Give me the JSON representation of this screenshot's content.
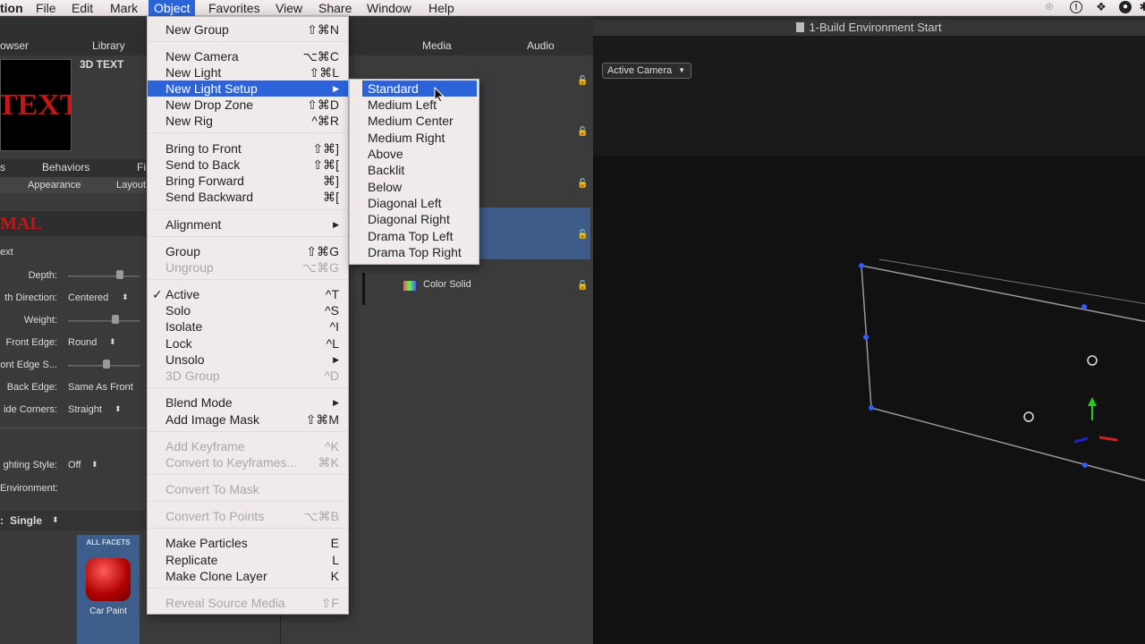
{
  "menubar": {
    "app": "tion",
    "items": [
      "File",
      "Edit",
      "Mark",
      "Object",
      "Favorites",
      "View",
      "Share",
      "Window",
      "Help"
    ],
    "active": "Object"
  },
  "window": {
    "title": "1-Build Environment Start"
  },
  "left_panel": {
    "tabs_top": [
      "owser",
      "Library"
    ],
    "preview_title": "3D TEXT",
    "preview_text": "TEXT",
    "tabs_mid": [
      "s",
      "Behaviors",
      "Fi"
    ],
    "subtabs": [
      "Appearance",
      "Layout"
    ],
    "style_title": "MAL",
    "section": "ext",
    "rows": [
      {
        "label": "Depth:",
        "value": ""
      },
      {
        "label": "th Direction:",
        "value": "Centered"
      },
      {
        "label": "Weight:",
        "value": ""
      },
      {
        "label": "Front Edge:",
        "value": "Round"
      },
      {
        "label": "ont Edge S...",
        "value": ""
      },
      {
        "label": "Back Edge:",
        "value": "Same As Front"
      },
      {
        "label": "ide Corners:",
        "value": "Straight"
      },
      {
        "label": "ghting Style:",
        "value": "Off"
      },
      {
        "label": "Environment:",
        "value": ""
      }
    ],
    "material_mode": "Single",
    "facets_label": "ALL FACETS",
    "material_name": "Car Paint"
  },
  "middle_panel": {
    "tabs": [
      "Media",
      "Audio"
    ],
    "layer_label": "Color Solid"
  },
  "viewer": {
    "camera": "Active Camera"
  },
  "object_menu": {
    "items": [
      {
        "label": "New Group",
        "shortcut": "⇧⌘N"
      },
      {
        "label": "New Camera",
        "shortcut": "⌥⌘C"
      },
      {
        "label": "New Light",
        "shortcut": "⇧⌘L"
      },
      {
        "label": "New Light Setup",
        "shortcut": "▶"
      },
      {
        "label": "New Drop Zone",
        "shortcut": "⇧⌘D"
      },
      {
        "label": "New Rig",
        "shortcut": "^⌘R"
      },
      {
        "label": "Bring to Front",
        "shortcut": "⇧⌘]"
      },
      {
        "label": "Send to Back",
        "shortcut": "⇧⌘["
      },
      {
        "label": "Bring Forward",
        "shortcut": "⌘]"
      },
      {
        "label": "Send Backward",
        "shortcut": "⌘["
      },
      {
        "label": "Alignment",
        "shortcut": "▶"
      },
      {
        "label": "Group",
        "shortcut": "⇧⌘G"
      },
      {
        "label": "Ungroup",
        "shortcut": "⌥⌘G"
      },
      {
        "label": "Active",
        "shortcut": "^T"
      },
      {
        "label": "Solo",
        "shortcut": "^S"
      },
      {
        "label": "Isolate",
        "shortcut": "^I"
      },
      {
        "label": "Lock",
        "shortcut": "^L"
      },
      {
        "label": "Unsolo",
        "shortcut": "▶"
      },
      {
        "label": "3D Group",
        "shortcut": "^D"
      },
      {
        "label": "Blend Mode",
        "shortcut": "▶"
      },
      {
        "label": "Add Image Mask",
        "shortcut": "⇧⌘M"
      },
      {
        "label": "Add Keyframe",
        "shortcut": "^K"
      },
      {
        "label": "Convert to Keyframes...",
        "shortcut": "⌘K"
      },
      {
        "label": "Convert To Mask",
        "shortcut": ""
      },
      {
        "label": "Convert To Points",
        "shortcut": "⌥⌘B"
      },
      {
        "label": "Make Particles",
        "shortcut": "E"
      },
      {
        "label": "Replicate",
        "shortcut": "L"
      },
      {
        "label": "Make Clone Layer",
        "shortcut": "K"
      },
      {
        "label": "Reveal Source Media",
        "shortcut": "⇧F"
      }
    ],
    "check_mark": "✓"
  },
  "light_submenu": {
    "items": [
      "Standard",
      "Medium Left",
      "Medium Center",
      "Medium Right",
      "Above",
      "Backlit",
      "Below",
      "Diagonal Left",
      "Diagonal Right",
      "Drama Top Left",
      "Drama Top Right"
    ]
  },
  "colors": {
    "highlight": "#2b64d8",
    "menu_bg": "#f6f0f0",
    "disabled": "#a8a8a8"
  }
}
